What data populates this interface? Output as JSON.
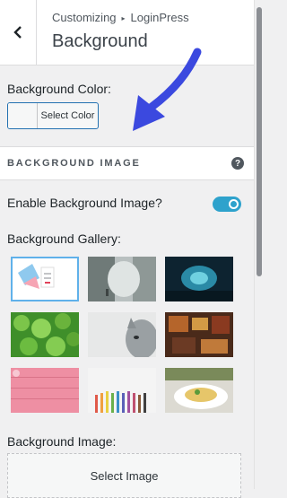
{
  "header": {
    "breadcrumb_prefix": "Customizing",
    "breadcrumb_sep": "▸",
    "breadcrumb_target": "LoginPress",
    "title": "Background"
  },
  "background_color": {
    "label": "Background Color:",
    "button_label": "Select Color"
  },
  "section": {
    "title": "BACKGROUND IMAGE",
    "help_glyph": "?"
  },
  "enable_image": {
    "label": "Enable Background Image?",
    "enabled": true
  },
  "gallery": {
    "label": "Background Gallery:",
    "items": [
      {
        "name": "login-form",
        "selected": true
      },
      {
        "name": "foggy-forest",
        "selected": false
      },
      {
        "name": "blue-cave",
        "selected": false
      },
      {
        "name": "clover-leaves",
        "selected": false
      },
      {
        "name": "cat",
        "selected": false
      },
      {
        "name": "cafe",
        "selected": false
      },
      {
        "name": "pink-wood",
        "selected": false
      },
      {
        "name": "colored-pencils",
        "selected": false
      },
      {
        "name": "pasta-dish",
        "selected": false
      }
    ]
  },
  "background_image": {
    "label": "Background Image:",
    "button_label": "Select Image"
  },
  "colors": {
    "accent": "#2271b1",
    "toggle": "#2ea2cc",
    "arrow": "#3b49df"
  }
}
